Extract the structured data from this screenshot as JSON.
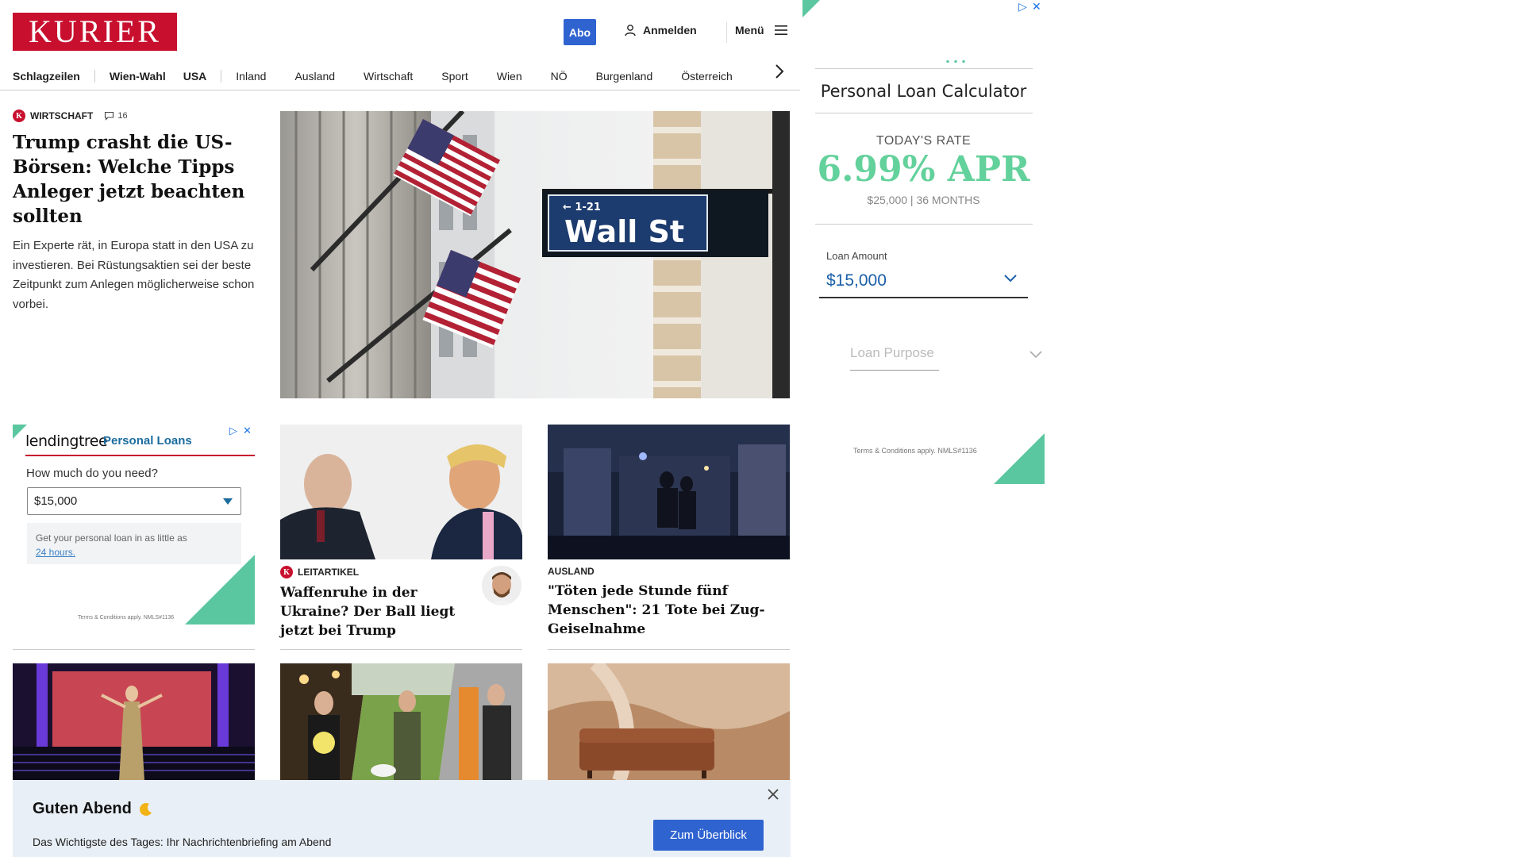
{
  "header": {
    "logo_text": "KURIER",
    "abo_label": "Abo",
    "login_label": "Anmelden",
    "menu_label": "Menü"
  },
  "nav": {
    "items": [
      {
        "label": "Schlagzeilen"
      },
      {
        "label": "Wien-Wahl"
      },
      {
        "label": "USA"
      },
      {
        "label": "Inland"
      },
      {
        "label": "Ausland"
      },
      {
        "label": "Wirtschaft"
      },
      {
        "label": "Sport"
      },
      {
        "label": "Wien"
      },
      {
        "label": "NÖ"
      },
      {
        "label": "Burgenland"
      },
      {
        "label": "Österreich"
      }
    ]
  },
  "hero": {
    "category": "WIRTSCHAFT",
    "comments": "16",
    "title": "Trump crasht die US-Börsen: Welche Tipps Anleger jetzt beachten sollten",
    "teaser": "Ein Experte rät, in Europa statt in den USA zu investieren. Bei Rüstungsaktien sei der beste Zeitpunkt zum Anlegen möglicherweise schon vorbei.",
    "image_sign_text": "Wall St",
    "image_sign_small": "← 1-21"
  },
  "ad_left": {
    "brand": "lendingtree",
    "product": "Personal Loans",
    "question": "How much do you need?",
    "select_value": "$15,000",
    "box_text": "Get your personal loan in as little as",
    "box_link": "24 hours.",
    "terms": "Terms & Conditions apply. NMLS#1136"
  },
  "cards": [
    {
      "category": "LEITARTIKEL",
      "title": "Waffenruhe in der Ukraine? Der Ball liegt jetzt bei Trump"
    },
    {
      "category": "AUSLAND",
      "title": "\"Töten jede Stunde fünf Menschen\": 21 Tote bei Zug-Geiselnahme"
    }
  ],
  "banner": {
    "title": "Guten Abend",
    "subtitle": "Das Wichtigste des Tages: Ihr Nachrichtenbriefing am Abend",
    "button_label": "Zum Überblick"
  },
  "ad_right": {
    "title": "Personal Loan Calculator",
    "rate_label": "TODAY'S RATE",
    "rate_value": "6.99% APR",
    "rate_terms": "$25,000 | 36 MONTHS",
    "loan_amount_label": "Loan Amount",
    "loan_amount_value": "$15,000",
    "loan_purpose_placeholder": "Loan Purpose",
    "terms": "Terms & Conditions apply. NMLS#1136"
  },
  "colors": {
    "brand_red": "#c8102e",
    "accent_blue": "#2f63d0",
    "ad_green": "#5bc7a0"
  }
}
